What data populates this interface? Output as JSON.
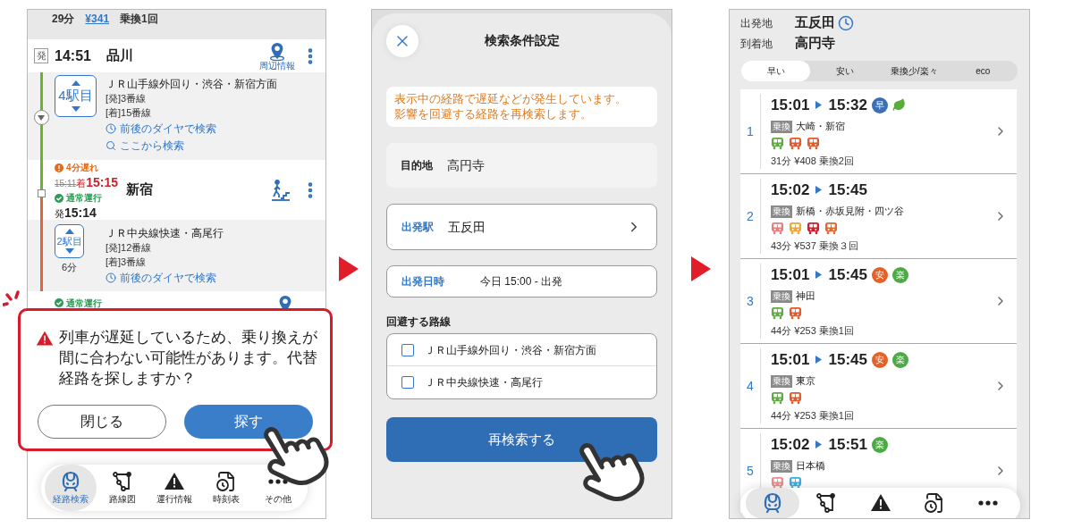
{
  "route_detail": {
    "summary": {
      "duration": "29分",
      "fare": "¥341",
      "transfers": "乗換1回"
    },
    "origin": {
      "badge": "発",
      "time": "14:51",
      "station": "品川",
      "map_label": "周辺情報"
    },
    "legs": [
      {
        "stops": "4駅目",
        "line": "ＪＲ山手線外回り・渋谷・新宿方面",
        "departure_track": "[発]3番線",
        "arrival_track": "[着]15番線",
        "links": [
          {
            "kind": "clock",
            "label": "前後のダイヤで検索"
          },
          {
            "kind": "search",
            "label": "ここから検索"
          }
        ]
      },
      {
        "stops": "2駅目",
        "duration": "6分",
        "line": "ＪＲ中央線快速・高尾行",
        "departure_track": "[発]12番線",
        "arrival_track": "[着]3番線",
        "links": [
          {
            "kind": "clock",
            "label": "前後のダイヤで検索"
          }
        ]
      }
    ],
    "transfer": {
      "delay": "4分遅れ",
      "scheduled": "15:11",
      "arrival_label": "着",
      "arrival": "15:15",
      "status": "通常運行",
      "departure_label": "発",
      "departure": "15:14",
      "station": "新宿"
    },
    "destination": {
      "status": "通常運行"
    },
    "alert": {
      "message": "列車が遅延しているため、乗り換えが間に合わない可能性があります。代替経路を探しますか？",
      "buttons": [
        {
          "label": "閉じる",
          "primary": false
        },
        {
          "label": "探す",
          "primary": true
        }
      ]
    },
    "nav": [
      {
        "label": "経路検索",
        "selected": true
      },
      {
        "label": "路線図",
        "selected": false
      },
      {
        "label": "運行情報",
        "selected": false
      },
      {
        "label": "時刻表",
        "selected": false
      },
      {
        "label": "その他",
        "selected": false
      }
    ]
  },
  "search_conditions": {
    "title": "検索条件設定",
    "notice_lines": [
      "表示中の経路で遅延などが発生しています。",
      "影響を回避する経路を再検索します。"
    ],
    "destination": {
      "label": "目的地",
      "value": "高円寺"
    },
    "departure_station": {
      "label": "出発駅",
      "value": "五反田"
    },
    "departure_time": {
      "label": "出発日時",
      "value": "今日 15:00 - 出発"
    },
    "avoid_heading": "回避する路線",
    "avoid_lines": [
      {
        "label": "ＪＲ山手線外回り・渋谷・新宿方面",
        "checked": false
      },
      {
        "label": "ＪＲ中央線快速・高尾行",
        "checked": false
      }
    ],
    "search_button": "再検索する"
  },
  "route_results": {
    "from": {
      "label": "出発地",
      "value": "五反田"
    },
    "to": {
      "label": "到着地",
      "value": "高円寺"
    },
    "sort_tabs": [
      {
        "label": "早い",
        "selected": true
      },
      {
        "label": "安い",
        "selected": false
      },
      {
        "label": "乗換少/楽々",
        "selected": false
      },
      {
        "label": "eco",
        "selected": false
      }
    ],
    "routes": [
      {
        "number": "1",
        "depart": "15:01",
        "arrive": "15:32",
        "badges": [
          {
            "kind": "text",
            "label": "早",
            "color": "#3b6fb6"
          },
          {
            "kind": "leaf",
            "color": "#5aad3c"
          }
        ],
        "transfer_tag": "乗換",
        "via": "大崎・新宿",
        "trains": [
          {
            "color": "#5fad3e"
          },
          {
            "color": "#e65a2a"
          },
          {
            "color": "#e65a2a"
          }
        ],
        "summary": "31分 ¥408 乗換2回"
      },
      {
        "number": "2",
        "depart": "15:02",
        "arrive": "15:45",
        "transfer_tag": "乗換",
        "via": "新橋・赤坂見附・四ツ谷",
        "trains": [
          {
            "color": "#ee7b7b"
          },
          {
            "color": "#f2a531"
          },
          {
            "color": "#d7192c"
          },
          {
            "color": "#e8662d"
          }
        ],
        "summary": "43分 ¥537 乗換３回"
      },
      {
        "number": "3",
        "depart": "15:01",
        "arrive": "15:45",
        "badges": [
          {
            "kind": "text",
            "label": "安",
            "color": "#e2622a"
          },
          {
            "kind": "text",
            "label": "楽",
            "color": "#4caa44"
          }
        ],
        "transfer_tag": "乗換",
        "via": "神田",
        "trains": [
          {
            "color": "#5fad3e"
          },
          {
            "color": "#e65a2a"
          }
        ],
        "summary": "44分 ¥253 乗換1回"
      },
      {
        "number": "4",
        "depart": "15:01",
        "arrive": "15:45",
        "badges": [
          {
            "kind": "text",
            "label": "安",
            "color": "#e2622a"
          },
          {
            "kind": "text",
            "label": "楽",
            "color": "#4caa44"
          }
        ],
        "transfer_tag": "乗換",
        "via": "東京",
        "trains": [
          {
            "color": "#5fad3e"
          },
          {
            "color": "#e65a2a"
          }
        ],
        "summary": "44分 ¥253 乗換1回"
      },
      {
        "number": "5",
        "depart": "15:02",
        "arrive": "15:51",
        "badges": [
          {
            "kind": "text",
            "label": "楽",
            "color": "#4caa44"
          }
        ],
        "transfer_tag": "乗換",
        "via": "日本橋",
        "trains": [
          {
            "color": "#ef8a8a"
          },
          {
            "color": "#3aaee0"
          }
        ]
      }
    ],
    "nav": [
      {
        "selected": true
      },
      {
        "selected": false
      },
      {
        "selected": false
      },
      {
        "selected": false
      },
      {
        "selected": false
      }
    ]
  }
}
